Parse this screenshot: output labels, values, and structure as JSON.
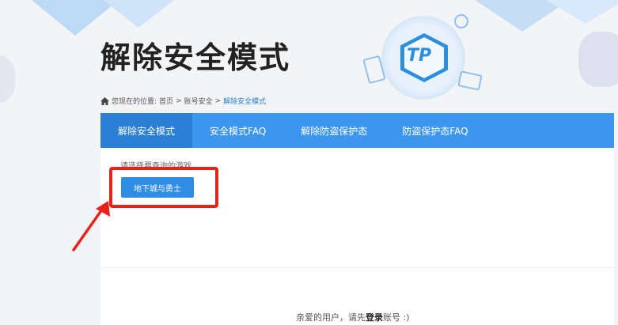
{
  "page": {
    "title": "解除安全模式"
  },
  "logo": {
    "text": "TP"
  },
  "breadcrumb": {
    "prefix": "您现在的位置:",
    "items": [
      "首页",
      "账号安全",
      "解除安全模式"
    ],
    "separator": ">"
  },
  "tabs": [
    {
      "label": "解除安全模式",
      "active": true
    },
    {
      "label": "安全模式FAQ",
      "active": false
    },
    {
      "label": "解除防盗保护态",
      "active": false
    },
    {
      "label": "防盗保护态FAQ",
      "active": false
    }
  ],
  "panel": {
    "prompt": "请选择要查询的游戏",
    "game_button": "地下城与勇士"
  },
  "footer": {
    "greeting": "亲爱的用户，请先",
    "login_link": "登录",
    "suffix": "账号 :)"
  },
  "colors": {
    "tab_bar": "#3d96ee",
    "tab_active": "#2a7fd4",
    "button": "#2f8de4",
    "highlight": "#e8211b"
  },
  "icons": [
    "home-icon",
    "tp-logo-icon",
    "annotation-arrow-icon"
  ]
}
